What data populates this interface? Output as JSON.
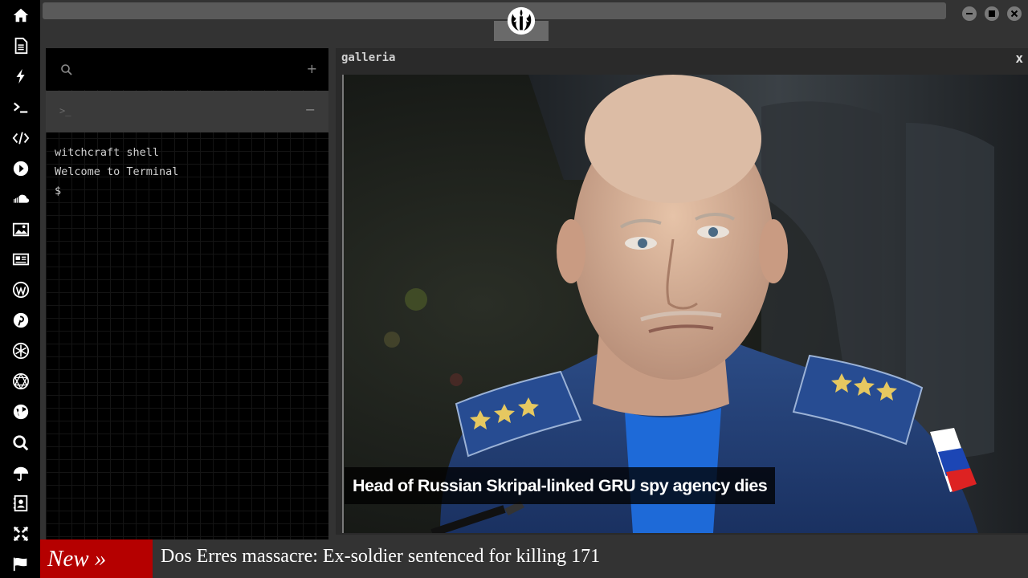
{
  "sidebar": {
    "items": [
      {
        "icon": "home-icon"
      },
      {
        "icon": "document-icon"
      },
      {
        "icon": "bolt-icon"
      },
      {
        "icon": "terminal-icon"
      },
      {
        "icon": "code-icon"
      },
      {
        "icon": "play-icon"
      },
      {
        "icon": "soundcloud-icon"
      },
      {
        "icon": "image-icon"
      },
      {
        "icon": "newspaper-icon"
      },
      {
        "icon": "wordpress-icon"
      },
      {
        "icon": "pinterest-icon"
      },
      {
        "icon": "snowflake-icon"
      },
      {
        "icon": "network-icon"
      },
      {
        "icon": "globe-icon"
      },
      {
        "icon": "search-icon"
      },
      {
        "icon": "umbrella-icon"
      },
      {
        "icon": "contact-icon"
      },
      {
        "icon": "expand-icon"
      },
      {
        "icon": "flag-icon"
      }
    ]
  },
  "topbar": {
    "logo_icon": "rebel-alliance-icon",
    "window_controls": [
      "minimize-icon",
      "maximize-icon",
      "close-icon"
    ]
  },
  "terminal": {
    "search_placeholder": "",
    "add_label": "+",
    "tab_prompt": ">_",
    "collapse_label": "−",
    "lines": [
      "witchcraft shell",
      "Welcome to Terminal"
    ],
    "prompt": "$"
  },
  "gallery": {
    "title": "galleria",
    "close_label": "x",
    "caption": "Head of Russian Skripal-linked GRU spy agency dies"
  },
  "ticker": {
    "badge": "New »",
    "headline": "Dos Erres massacre: Ex-soldier sentenced for killing 171"
  },
  "colors": {
    "sidebar_bg": "#000000",
    "chrome_bg": "#333333",
    "ticker_badge": "#b50000",
    "panel_bg": "#000000"
  }
}
